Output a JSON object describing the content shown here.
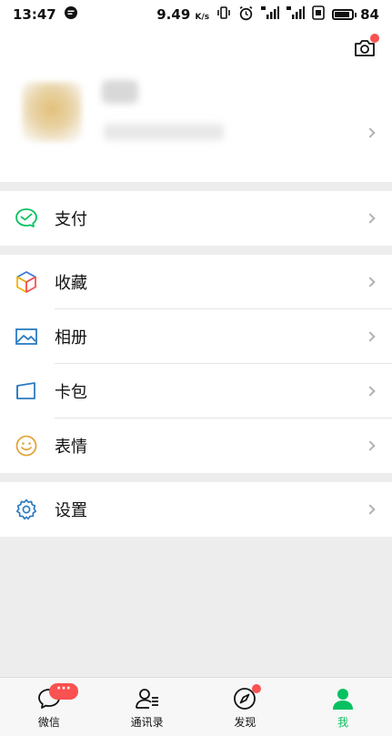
{
  "status_bar": {
    "time": "13:47",
    "network_speed": "9.49",
    "speed_unit": "K/s",
    "battery_level": "84"
  },
  "profile": {
    "has_camera_notification": true
  },
  "menu": {
    "pay": {
      "label": "支付",
      "icon": "pay-icon"
    },
    "favorites": {
      "label": "收藏",
      "icon": "cube-icon"
    },
    "album": {
      "label": "相册",
      "icon": "image-icon"
    },
    "cards": {
      "label": "卡包",
      "icon": "card-icon"
    },
    "stickers": {
      "label": "表情",
      "icon": "smile-icon"
    },
    "settings": {
      "label": "设置",
      "icon": "gear-icon"
    }
  },
  "bottom_nav": {
    "items": [
      {
        "label": "微信",
        "icon": "chat-icon",
        "badge": "···"
      },
      {
        "label": "通讯录",
        "icon": "contacts-icon"
      },
      {
        "label": "发现",
        "icon": "compass-icon",
        "has_dot": true
      },
      {
        "label": "我",
        "icon": "person-icon",
        "active": true
      }
    ]
  },
  "colors": {
    "accent_green": "#07c160",
    "badge_red": "#fa5151",
    "page_background": "#ededed"
  }
}
